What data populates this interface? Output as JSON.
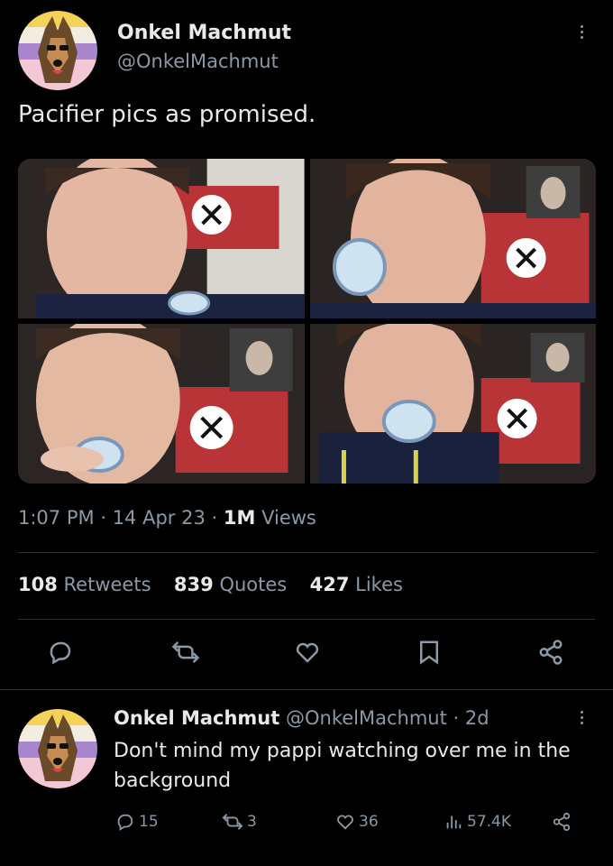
{
  "tweet": {
    "display_name": "Onkel Machmut",
    "handle": "@OnkelMachmut",
    "text": "Pacifier pics as promised.",
    "time": "1:07 PM",
    "date": "14 Apr 23",
    "views_count": "1M",
    "views_label": "Views",
    "separator": "·"
  },
  "stats": {
    "retweets_count": "108",
    "retweets_label": "Retweets",
    "quotes_count": "839",
    "quotes_label": "Quotes",
    "likes_count": "427",
    "likes_label": "Likes"
  },
  "reply": {
    "display_name": "Onkel Machmut",
    "handle": "@OnkelMachmut",
    "age": "· 2d",
    "text": "Don't mind my pappi watching over me in the background",
    "replies": "15",
    "retweets": "3",
    "likes": "36",
    "views": "57.4K"
  },
  "icons": {
    "reply": "reply-icon",
    "retweet": "retweet-icon",
    "like": "heart-icon",
    "bookmark": "bookmark-icon",
    "share": "share-icon",
    "views": "views-icon",
    "more": "more-icon"
  },
  "colors": {
    "background": "#000000",
    "text": "#e7e9ea",
    "muted": "#8b98a5",
    "divider": "#2f3336"
  }
}
